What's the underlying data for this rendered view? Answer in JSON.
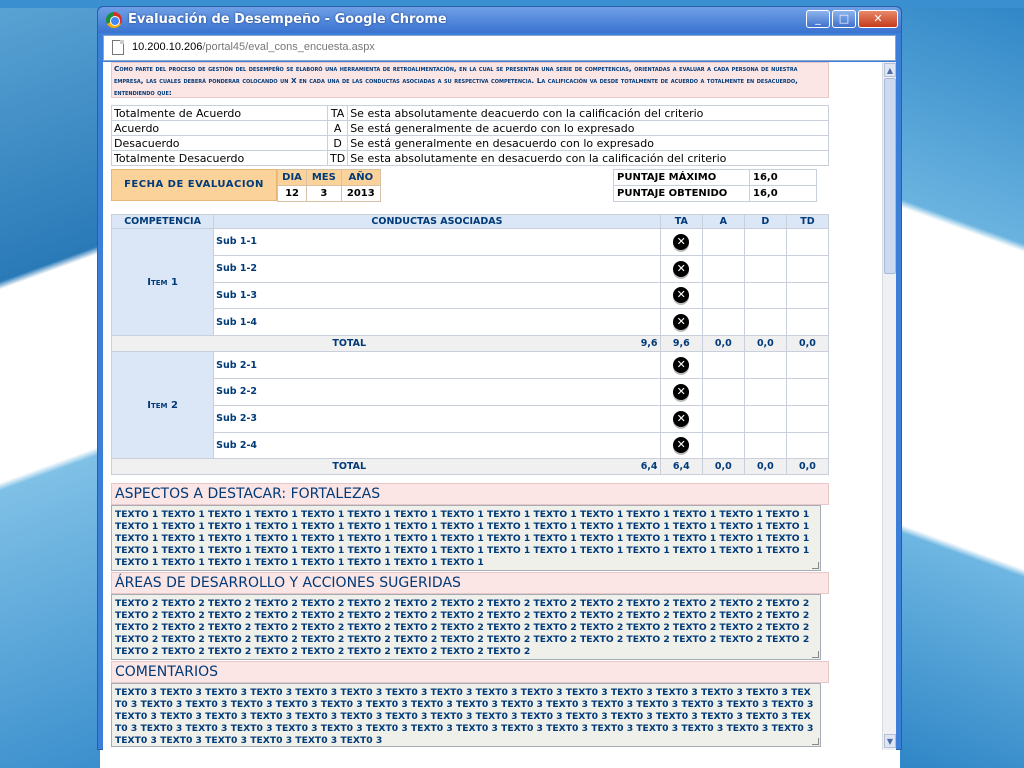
{
  "window": {
    "title": "Evaluación de Desempeño - Google Chrome",
    "url_host": "10.200.10.206",
    "url_path": "/portal45/eval_cons_encuesta.aspx",
    "minimize": "_",
    "maximize": "□",
    "close": "✕"
  },
  "intro": "Como parte del proceso de gestión del desempeño se elaboró una herramienta de retroalimentación, en la cual se presentan una serie de competencias, orientadas a evaluar a cada persona de nuestra empresa, las cuales deberá ponderar colocando un X en cada una de las conductas asociadas a su respectiva competencia. La calificación va desde totalmente de acuerdo a totalmente en desacuerdo, entendiendo que:",
  "legend": [
    {
      "label": "Totalmente de Acuerdo",
      "code": "TA",
      "desc": "Se esta absolutamente deacuerdo con la calificación del criterio"
    },
    {
      "label": "Acuerdo",
      "code": "A",
      "desc": "Se está generalmente de acuerdo con lo expresado"
    },
    {
      "label": "Desacuerdo",
      "code": "D",
      "desc": "Se está generalmente en desacuerdo con lo expresado"
    },
    {
      "label": "Totalmente Desacuerdo",
      "code": "TD",
      "desc": "Se esta absolutamente en desacuerdo con la calificación del criterio"
    }
  ],
  "fecha": {
    "label": "FECHA DE EVALUACION",
    "dia_h": "DIA",
    "mes_h": "MES",
    "anio_h": "AÑO",
    "dia": "12",
    "mes": "3",
    "anio": "2013"
  },
  "puntaje": {
    "max_label": "PUNTAJE MÁXIMO",
    "max": "16,0",
    "obt_label": "PUNTAJE OBTENIDO",
    "obt": "16,0"
  },
  "table": {
    "headers": {
      "competencia": "COMPETENCIA",
      "conductas": "CONDUCTAS ASOCIADAS",
      "ta": "TA",
      "a": "A",
      "d": "D",
      "td": "TD"
    },
    "mark": "✕",
    "total_label": "TOTAL",
    "items": [
      {
        "name": "Item 1",
        "subs": [
          "Sub 1-1",
          "Sub 1-2",
          "Sub 1-3",
          "Sub 1-4"
        ],
        "total": "9,6",
        "ta": "9,6",
        "a": "0,0",
        "d": "0,0",
        "td": "0,0"
      },
      {
        "name": "Item 2",
        "subs": [
          "Sub 2-1",
          "Sub 2-2",
          "Sub 2-3",
          "Sub 2-4"
        ],
        "total": "6,4",
        "ta": "6,4",
        "a": "0,0",
        "d": "0,0",
        "td": "0,0"
      }
    ]
  },
  "sections": {
    "fortalezas_title": "ASPECTOS A DESTACAR: FORTALEZAS",
    "fortalezas_text": "TEXTO 1 TEXTO 1 TEXTO 1 TEXTO 1 TEXTO 1 TEXTO 1 TEXTO 1 TEXTO 1 TEXTO 1 TEXTO 1 TEXTO 1 TEXTO 1 TEXTO 1 TEXTO 1 TEXTO 1 TEXTO 1 TEXTO 1 TEXTO 1 TEXTO 1 TEXTO 1 TEXTO 1 TEXTO 1 TEXTO 1 TEXTO 1 TEXTO 1 TEXTO 1 TEXTO 1 TEXTO 1 TEXTO 1 TEXTO 1 TEXTO 1 TEXTO 1 TEXTO 1 TEXTO 1 TEXTO 1 TEXTO 1 TEXTO 1 TEXTO 1 TEXTO 1 TEXTO 1 TEXTO 1 TEXTO 1 TEXTO 1 TEXTO 1 TEXTO 1 TEXTO 1 TEXTO 1 TEXTO 1 TEXTO 1 TEXTO 1 TEXTO 1 TEXTO 1 TEXTO 1 TEXTO 1 TEXTO 1 TEXTO 1 TEXTO 1 TEXTO 1 TEXTO 1 TEXTO 1 TEXTO 1 TEXTO 1 TEXTO 1 TEXTO 1 TEXTO 1 TEXTO 1 TEXTO 1 TEXTO 1",
    "desarrollo_title": "ÁREAS DE DESARROLLO Y ACCIONES SUGERIDAS",
    "desarrollo_text": "TEXTO 2 TEXTO 2 TEXTO 2 TEXTO 2 TEXTO 2 TEXTO 2 TEXTO 2 TEXTO 2 TEXTO 2 TEXTO 2 TEXTO 2 TEXTO 2 TEXTO 2 TEXTO 2 TEXTO 2 TEXTO 2 TEXTO 2 TEXTO 2 TEXTO 2 TEXTO 2 TEXTO 2 TEXTO 2 TEXTO 2 TEXTO 2 TEXTO 2 TEXTO 2 TEXTO 2 TEXTO 2 TEXTO 2 TEXTO 2 TEXTO 2 TEXTO 2 TEXTO 2 TEXTO 2 TEXTO 2 TEXTO 2 TEXTO 2 TEXTO 2 TEXTO 2 TEXTO 2 TEXTO 2 TEXTO 2 TEXTO 2 TEXTO 2 TEXTO 2 TEXTO 2 TEXTO 2 TEXTO 2 TEXTO 2 TEXTO 2 TEXTO 2 TEXTO 2 TEXTO 2 TEXTO 2 TEXTO 2 TEXTO 2 TEXTO 2 TEXTO 2 TEXTO 2 TEXTO 2 TEXTO 2 TEXTO 2 TEXTO 2 TEXTO 2 TEXTO 2 TEXTO 2 TEXTO 2 TEXTO 2 TEXTO 2",
    "comentarios_title": "COMENTARIOS",
    "comentarios_text": "TEXT0 3 TEXT0 3 TEXT0 3 TEXT0 3 TEXT0 3 TEXT0 3 TEXT0 3 TEXT0 3 TEXT0 3 TEXT0 3 TEXT0 3 TEXT0 3 TEXT0 3 TEXT0 3 TEXT0 3 TEXT0 3 TEXT0 3 TEXT0 3 TEXT0 3 TEXT0 3 TEXT0 3 TEXT0 3 TEXT0 3 TEXT0 3 TEXT0 3 TEXT0 3 TEXT0 3 TEXT0 3 TEXT0 3 TEXT0 3 TEXT0 3 TEXT0 3 TEXT0 3 TEXT0 3 TEXT0 3 TEXT0 3 TEXT0 3 TEXT0 3 TEXT0 3 TEXT0 3 TEXT0 3 TEXT0 3 TEXT0 3 TEXT0 3 TEXT0 3 TEXT0 3 TEXT0 3 TEXT0 3 TEXT0 3 TEXT0 3 TEXT0 3 TEXT0 3 TEXT0 3 TEXT0 3 TEXT0 3 TEXT0 3 TEXT0 3 TEXT0 3 TEXT0 3 TEXT0 3 TEXT0 3 TEXT0 3 TEXT0 3 TEXT0 3 TEXT0 3 TEXT0 3 TEXT0 3 TEXT0 3"
  },
  "icons": {
    "chrome": "chrome-logo-icon",
    "page": "page-icon",
    "scroll_up": "▲",
    "scroll_down": "▼"
  }
}
